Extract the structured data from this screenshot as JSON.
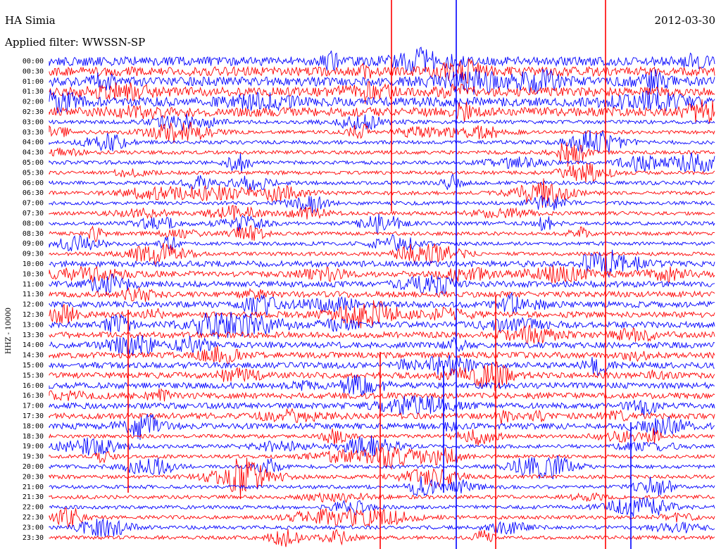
{
  "header": {
    "station": "HA Simia",
    "filter_label": "Applied filter: WWSSN-SP",
    "date": "2012-03-30"
  },
  "chart_data": {
    "type": "line",
    "ylabel": "HHZ - 10000",
    "rows": [
      "00:00",
      "00:30",
      "01:00",
      "01:30",
      "02:00",
      "02:30",
      "03:00",
      "03:30",
      "04:00",
      "04:30",
      "05:00",
      "05:30",
      "06:00",
      "06:30",
      "07:00",
      "07:30",
      "08:00",
      "08:30",
      "09:00",
      "09:30",
      "10:00",
      "10:30",
      "11:00",
      "11:30",
      "12:00",
      "12:30",
      "13:00",
      "13:30",
      "14:00",
      "14:30",
      "15:00",
      "15:30",
      "16:00",
      "16:30",
      "17:00",
      "17:30",
      "18:00",
      "18:30",
      "19:00",
      "19:30",
      "20:00",
      "20:30",
      "21:00",
      "21:30",
      "22:00",
      "22:30",
      "23:00",
      "23:30"
    ],
    "series_colors": [
      "#0000ff",
      "#ff0000"
    ]
  }
}
